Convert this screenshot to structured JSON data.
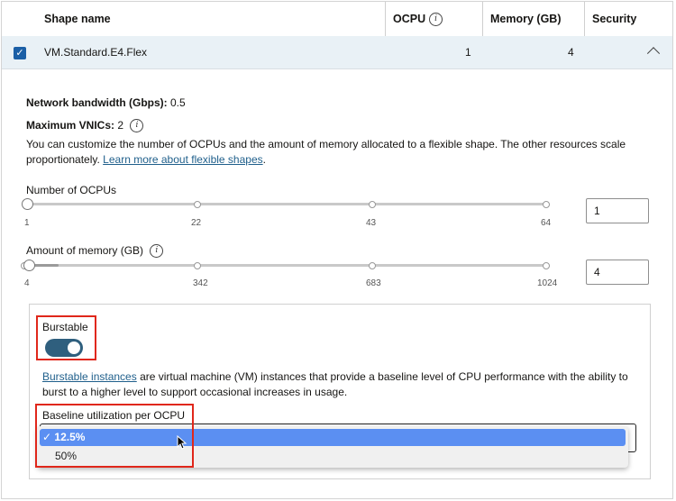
{
  "table": {
    "headers": {
      "shape_name": "Shape name",
      "ocpu": "OCPU",
      "memory": "Memory (GB)",
      "security": "Security"
    },
    "row": {
      "shape": "VM.Standard.E4.Flex",
      "ocpu": "1",
      "memory": "4",
      "checked": true
    }
  },
  "details": {
    "network_label": "Network bandwidth (Gbps):",
    "network_value": "0.5",
    "vnics_label": "Maximum VNICs:",
    "vnics_value": "2",
    "description": "You can customize the number of OCPUs and the amount of memory allocated to a flexible shape. The other resources scale proportionately.",
    "learn_more_link": "Learn more about flexible shapes",
    "period": "."
  },
  "ocpu_slider": {
    "label": "Number of OCPUs",
    "ticks": [
      "1",
      "22",
      "43",
      "64"
    ],
    "value": "1"
  },
  "memory_slider": {
    "label": "Amount of memory (GB)",
    "ticks": [
      "4",
      "342",
      "683",
      "1024"
    ],
    "value": "4"
  },
  "burstable": {
    "label": "Burstable",
    "enabled": true,
    "link": "Burstable instances",
    "description": " are virtual machine (VM) instances that provide a baseline level of CPU performance with the ability to burst to a higher level to support occasional increases in usage.",
    "baseline_label": "Baseline utilization per OCPU",
    "options": [
      "12.5%",
      "50%"
    ],
    "selected": "12.5%",
    "check_mark": "✓"
  },
  "colors": {
    "accent": "#2f5f7e",
    "checkbox": "#1b5fa6",
    "selected_option": "#5b8ff2",
    "highlight_box": "#e0271b",
    "link": "#1f5f8b"
  }
}
